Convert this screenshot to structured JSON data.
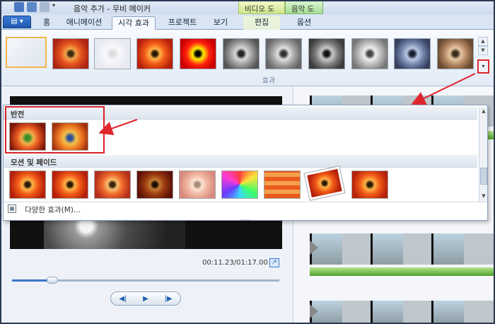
{
  "window": {
    "title": "음악 추가 - 무비 메이커"
  },
  "context_tabs": {
    "video_tools": "비디오 도구",
    "music_tools": "음악 도구"
  },
  "tabs": [
    {
      "label": "홈"
    },
    {
      "label": "애니메이션"
    },
    {
      "label": "시각 효과"
    },
    {
      "label": "프로젝트"
    },
    {
      "label": "보기"
    },
    {
      "label": "편집"
    },
    {
      "label": "옵션"
    }
  ],
  "ribbon": {
    "group_label": "효과"
  },
  "dropdown": {
    "section_invert": "반전",
    "section_motion": "모션 및 페이드",
    "more_effects": "다양한 효과(M)..."
  },
  "player": {
    "timecode": "00:11.23/01:17.00",
    "progress": 0.15
  },
  "icons": {
    "file_menu": "file-menu-icon",
    "save": "save-icon",
    "undo": "undo-icon",
    "redo": "redo-icon",
    "fullscreen": "fullscreen-icon",
    "prev_frame": "previous-frame-icon",
    "play": "play-icon",
    "next_frame": "next-frame-icon"
  },
  "colors": {
    "accent": "#1f58b0",
    "highlight": "#d9212a",
    "selected": "#f2b64a"
  }
}
